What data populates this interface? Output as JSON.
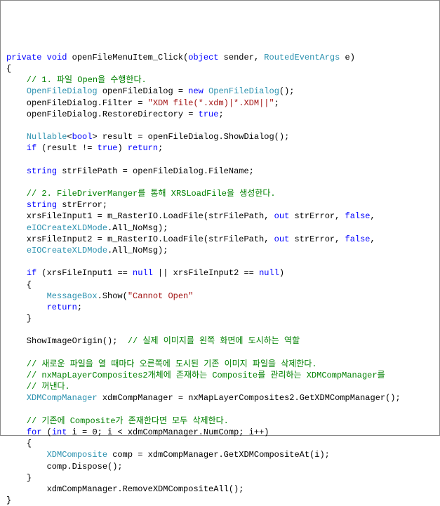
{
  "code": {
    "line1_kw1": "private",
    "line1_kw2": "void",
    "line1_method": " openFileMenuItem_Click(",
    "line1_kw3": "object",
    "line1_sender": " sender, ",
    "line1_type": "RoutedEventArgs",
    "line1_e": " e)",
    "line2": "{",
    "line3_cmt": "    // 1. 파일 Open을 수행한다.",
    "line4_indent": "    ",
    "line4_type": "OpenFileDialog",
    "line4_var": " openFileDialog = ",
    "line4_kw": "new",
    "line4_type2": " OpenFileDialog",
    "line4_end": "();",
    "line5_indent": "    openFileDialog.Filter = ",
    "line5_str": "\"XDM file(*.xdm)|*.XDM||\"",
    "line5_end": ";",
    "line6_indent": "    openFileDialog.RestoreDirectory = ",
    "line6_kw": "true",
    "line6_end": ";",
    "line8_indent": "    ",
    "line8_type": "Nullable",
    "line8_lt": "<",
    "line8_kw": "bool",
    "line8_gt": "> result = openFileDialog.ShowDialog();",
    "line9_indent": "    ",
    "line9_kw1": "if",
    "line9_mid": " (result != ",
    "line9_kw2": "true",
    "line9_mid2": ") ",
    "line9_kw3": "return",
    "line9_end": ";",
    "line11_indent": "    ",
    "line11_kw": "string",
    "line11_rest": " strFilePath = openFileDialog.FileName;",
    "line13_cmt": "    // 2. FileDriverManger를 통해 XRSLoadFile을 생성한다.",
    "line14_indent": "    ",
    "line14_kw": "string",
    "line14_rest": " strError;",
    "line15_indent": "    xrsFileInput1 = m_RasterIO.LoadFile(strFilePath, ",
    "line15_kw": "out",
    "line15_mid": " strError, ",
    "line15_kw2": "false",
    "line15_end": ",",
    "line16_indent": "    ",
    "line16_type": "eIOCreateXLDMode",
    "line16_rest": ".All_NoMsg);",
    "line17_indent": "    xrsFileInput2 = m_RasterIO.LoadFile(strFilePath, ",
    "line17_kw": "out",
    "line17_mid": " strError, ",
    "line17_kw2": "false",
    "line17_end": ",",
    "line18_indent": "    ",
    "line18_type": "eIOCreateXLDMode",
    "line18_rest": ".All_NoMsg);",
    "line20_indent": "    ",
    "line20_kw": "if",
    "line20_mid": " (xrsFileInput1 == ",
    "line20_kw2": "null",
    "line20_mid2": " || xrsFileInput2 == ",
    "line20_kw3": "null",
    "line20_end": ")",
    "line21": "    {",
    "line22_indent": "        ",
    "line22_type": "MessageBox",
    "line22_mid": ".Show(",
    "line22_str": "\"Cannot Open\"",
    "line23_indent": "        ",
    "line23_kw": "return",
    "line23_end": ";",
    "line24": "    }",
    "line26_indent": "    ShowImageOrigin();  ",
    "line26_cmt": "// 실제 이미지를 왼쪽 화면에 도시하는 역할",
    "line28_cmt": "    // 새로운 파일을 열 때마다 오른쪽에 도시된 기존 이미지 파일을 삭제한다.",
    "line29_cmt": "    // nxMapLayerComposites2개체에 존재하는 Composite를 관리하는 XDMCompManager를",
    "line30_cmt": "    // 꺼낸다.",
    "line31_indent": "    ",
    "line31_type": "XDMCompManager",
    "line31_rest": " xdmCompManager = nxMapLayerComposites2.GetXDMCompManager();",
    "line33_cmt": "    // 기존에 Composite가 존재한다면 모두 삭제한다.",
    "line34_indent": "    ",
    "line34_kw1": "for",
    "line34_mid1": " (",
    "line34_kw2": "int",
    "line34_mid2": " i = 0; i < xdmCompManager.NumComp; i++)",
    "line35": "    {",
    "line36_indent": "        ",
    "line36_type": "XDMComposite",
    "line36_rest": " comp = xdmCompManager.GetXDMCompositeAt(i);",
    "line37": "        comp.Dispose();",
    "line38": "    }",
    "line39": "        xdmCompManager.RemoveXDMCompositeAll();",
    "line40": "}"
  }
}
